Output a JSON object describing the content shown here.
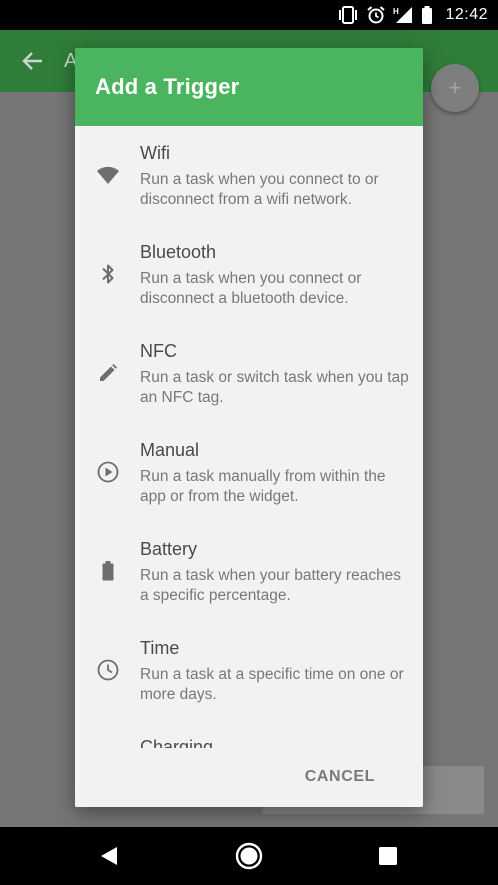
{
  "status_bar": {
    "time": "12:42",
    "icons": [
      "vibrate-icon",
      "alarm-icon",
      "signal-icon",
      "battery-icon"
    ]
  },
  "app_bar": {
    "title_peek": "A",
    "back_icon": "arrow-left-icon",
    "fab_label": "+"
  },
  "dialog": {
    "title": "Add a Trigger",
    "triggers": [
      {
        "name": "Wifi",
        "description": "Run a task when you connect to or disconnect from a wifi network.",
        "icon": "wifi-icon"
      },
      {
        "name": "Bluetooth",
        "description": "Run a task when you connect or disconnect a bluetooth device.",
        "icon": "bluetooth-icon"
      },
      {
        "name": "NFC",
        "description": "Run a task or switch task when you tap an NFC tag.",
        "icon": "pencil-icon"
      },
      {
        "name": "Manual",
        "description": "Run a task manually from within the app or from the widget.",
        "icon": "play-circle-icon"
      },
      {
        "name": "Battery",
        "description": "Run a task when your battery reaches a specific percentage.",
        "icon": "battery-icon"
      },
      {
        "name": "Time",
        "description": "Run a task at a specific time on one or more days.",
        "icon": "clock-icon"
      },
      {
        "name": "Charging",
        "description": "",
        "icon": ""
      }
    ],
    "cancel_label": "CANCEL"
  },
  "nav_bar": {
    "buttons": [
      "back-triangle-icon",
      "home-circle-icon",
      "recents-square-icon"
    ]
  },
  "colors": {
    "dialog_header": "#4ab45e",
    "app_bar": "#2f7d39",
    "dialog_background": "#f2f2f2"
  }
}
